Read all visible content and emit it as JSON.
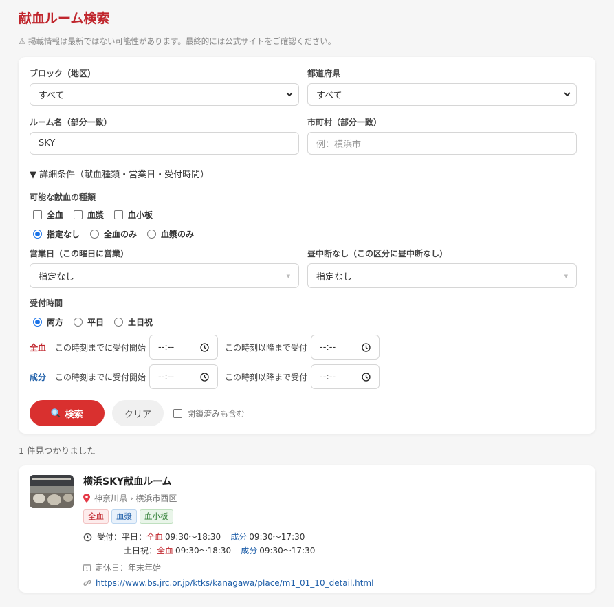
{
  "title": "献血ルーム検索",
  "notice": "⚠ 掲載情報は最新ではない可能性があります。最終的には公式サイトをご確認ください。",
  "form": {
    "block_label": "ブロック（地区）",
    "block_value": "すべて",
    "pref_label": "都道府県",
    "pref_value": "すべて",
    "room_label": "ルーム名（部分一致）",
    "room_value": "SKY",
    "city_label": "市町村（部分一致）",
    "city_placeholder": "例：横浜市",
    "details_toggle": "▼ 詳細条件（献血種類・営業日・受付時間）",
    "types_label": "可能な献血の種類",
    "type_checks": [
      "全血",
      "血漿",
      "血小板"
    ],
    "type_radios": [
      "指定なし",
      "全血のみ",
      "血漿のみ"
    ],
    "type_radio_selected": "指定なし",
    "open_day_label": "営業日（この曜日に営業）",
    "open_day_value": "指定なし",
    "no_break_label": "昼中断なし（この区分に昼中断なし）",
    "no_break_value": "指定なし",
    "reception_label": "受付時間",
    "reception_radios": [
      "両方",
      "平日",
      "土日祝"
    ],
    "reception_selected": "両方",
    "whole_tag": "全血",
    "component_tag": "成分",
    "start_text": "この時刻までに受付開始",
    "end_text": "この時刻以降まで受付",
    "time_placeholder": "--:--",
    "search_label": "検索",
    "clear_label": "クリア",
    "include_closed": "閉鎖済みも含む"
  },
  "colors": {
    "accent": "#c0262d",
    "button": "#d9302f",
    "blue": "#1f5fa9"
  },
  "results": {
    "count_text": "1 件見つかりました",
    "items": [
      {
        "name": "横浜SKY献血ルーム",
        "location": "神奈川県 › 横浜市西区",
        "badges": [
          "全血",
          "血漿",
          "血小板"
        ],
        "weekday_prefix": "受付：平日：",
        "weekday_whole_tag": "全血",
        "weekday_whole": "09:30～18:30",
        "weekday_comp_tag": "成分",
        "weekday_comp": "09:30～17:30",
        "holiday_prefix": "土日祝：",
        "holiday_whole_tag": "全血",
        "holiday_whole": "09:30～18:30",
        "holiday_comp_tag": "成分",
        "holiday_comp": "09:30～17:30",
        "closed_days": "定休日：年末年始",
        "url": "https://www.bs.jrc.or.jp/ktks/kanagawa/place/m1_01_10_detail.html"
      }
    ]
  }
}
